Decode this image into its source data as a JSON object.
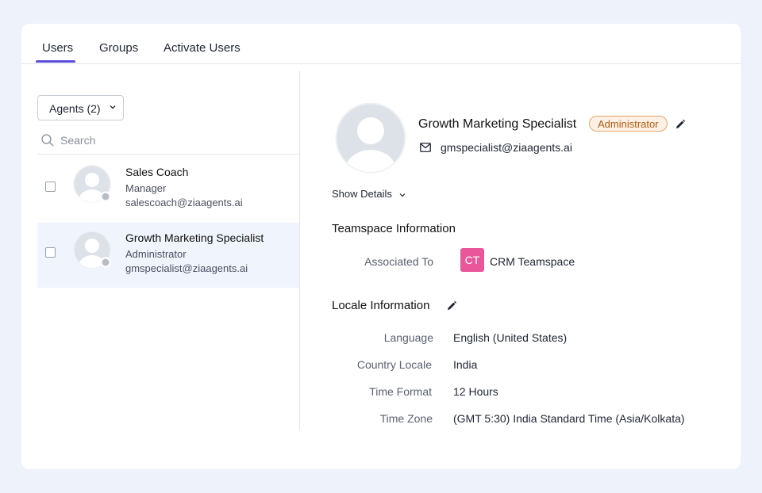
{
  "tabs": [
    "Users",
    "Groups",
    "Activate Users"
  ],
  "filter": {
    "label": "Agents (2)"
  },
  "search": {
    "placeholder": "Search"
  },
  "users": [
    {
      "name": "Sales Coach",
      "role": "Manager",
      "email": "salescoach@ziaagents.ai"
    },
    {
      "name": "Growth Marketing Specialist",
      "role": "Administrator",
      "email": "gmspecialist@ziaagents.ai"
    }
  ],
  "profile": {
    "name": "Growth Marketing Specialist",
    "badge": "Administrator",
    "email": "gmspecialist@ziaagents.ai",
    "show_details": "Show Details"
  },
  "teamspace": {
    "title": "Teamspace Information",
    "label": "Associated To",
    "initials": "CT",
    "value": "CRM Teamspace"
  },
  "locale": {
    "title": "Locale Information",
    "rows": [
      {
        "label": "Language",
        "value": "English (United States)"
      },
      {
        "label": "Country Locale",
        "value": "India"
      },
      {
        "label": "Time Format",
        "value": "12 Hours"
      },
      {
        "label": "Time Zone",
        "value": "(GMT 5:30) India Standard Time (Asia/Kolkata)"
      }
    ]
  },
  "colors": {
    "accent": "#5b4ed8",
    "badge_border": "#e8a36a",
    "badge_text": "#b4590e",
    "teamspace_badge": "#e9579a",
    "selected_row": "#f0f4fc"
  },
  "icons": [
    "chevron-down-icon",
    "search-icon",
    "user-avatar-icon",
    "status-dot-icon",
    "pencil-icon",
    "mail-icon"
  ]
}
